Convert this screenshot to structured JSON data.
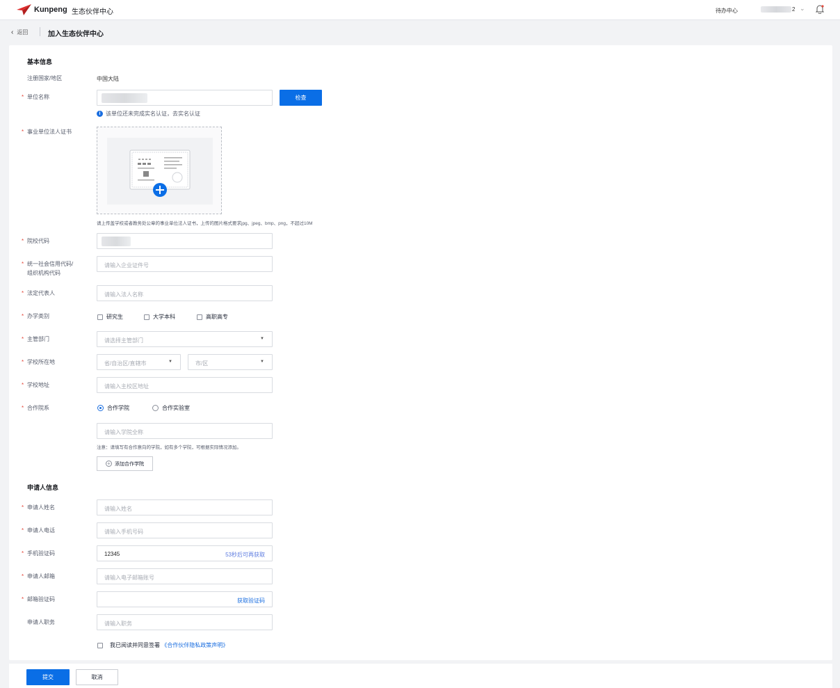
{
  "header": {
    "brand": "Kunpeng",
    "subtitle": "生态伙伴中心",
    "todo": "待办中心",
    "user_suffix": "2"
  },
  "breadcrumb": {
    "back": "返回",
    "title": "加入生态伙伴中心"
  },
  "basic": {
    "section_title": "基本信息",
    "country_label": "注册国家/地区",
    "country_value": "中国大陆",
    "unit_name_label": "单位名称",
    "check_button": "检查",
    "verify_hint": "该单位还未完成实名认证，去实名认证",
    "cert_label": "事业单位法人证书",
    "cert_note": "请上传盖学校或者教务处公章的事业单位法人证书，上传的图片格式要求jpg、jpeg、bmp、png，不超过10M",
    "school_code_label": "院校代码",
    "credit_code_label_1": "统一社会信用代码/",
    "credit_code_label_2": "组织机构代码",
    "credit_code_placeholder": "请输入企业证件号",
    "legal_rep_label": "法定代表人",
    "legal_rep_placeholder": "请输入法人名称",
    "school_type_label": "办学类别",
    "school_type_options": [
      "研究生",
      "大学本科",
      "高职高专"
    ],
    "dept_label": "主管部门",
    "dept_placeholder": "请选择主管部门",
    "location_label": "学校所在地",
    "province_placeholder": "省/自治区/直辖市",
    "city_placeholder": "市/区",
    "address_label": "学校地址",
    "address_placeholder": "请输入主校区地址",
    "coop_label": "合作院系",
    "coop_options": [
      "合作学院",
      "合作实验室"
    ],
    "college_placeholder": "请输入学院全称",
    "coop_note": "注意：请填写有合作意向的学院，如有多个学院，可根据实际情况添加。",
    "add_college": "添加合作学院"
  },
  "applicant": {
    "section_title": "申请人信息",
    "name_label": "申请人姓名",
    "name_placeholder": "请输入姓名",
    "phone_label": "申请人电话",
    "phone_placeholder": "请输入手机号码",
    "sms_label": "手机验证码",
    "sms_value": "12345",
    "sms_countdown": "53秒后可再获取",
    "email_label": "申请人邮箱",
    "email_placeholder": "请输入电子邮箱账号",
    "email_code_label": "邮箱验证码",
    "email_code_button": "获取验证码",
    "position_label": "申请人职务",
    "position_placeholder": "请输入职务",
    "agree_text": "我已阅读并同意签署",
    "agree_link": "《合作伙伴隐私政策声明》"
  },
  "footer": {
    "submit": "提交",
    "cancel": "取消"
  },
  "colors": {
    "primary": "#0a6ee6",
    "link": "#1a6ee0",
    "required": "#e4493c"
  }
}
